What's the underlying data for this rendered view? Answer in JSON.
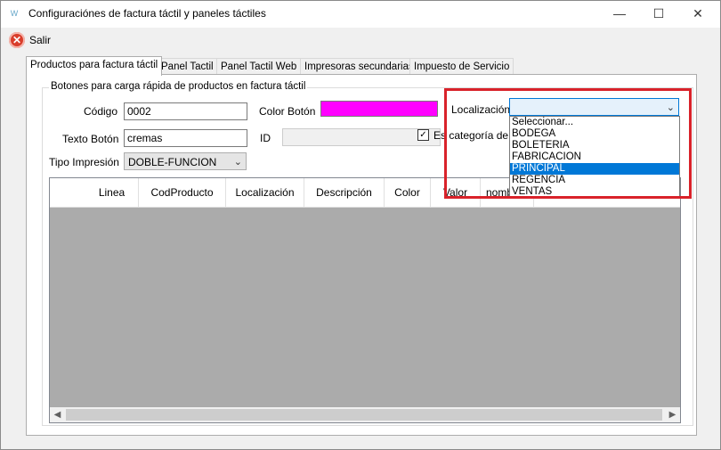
{
  "window": {
    "title": "Configuraciónes de factura táctil y paneles táctiles",
    "app_icon": "W"
  },
  "toolbar": {
    "exit_label": "Salir"
  },
  "tabs": [
    {
      "label": "Productos para factura táctil"
    },
    {
      "label": "Panel Tactil"
    },
    {
      "label": "Panel Tactil Web"
    },
    {
      "label": "Impresoras secundarias"
    },
    {
      "label": "Impuesto de Servicio"
    }
  ],
  "group": {
    "title": "Botones para carga rápida de productos  en factura táctil"
  },
  "form": {
    "codigo_label": "Código",
    "codigo_value": "0002",
    "texto_label": "Texto Botón",
    "texto_value": "cremas",
    "tipo_label": "Tipo Impresión",
    "tipo_value": "DOBLE-FUNCION",
    "color_label": "Color Botón",
    "color_value": "#ff00ff",
    "id_label": "ID",
    "id_value": "",
    "subcat_label": "Es categoría de p",
    "localizacion_label": "Localización",
    "localizacion_value": ""
  },
  "grid": {
    "columns": [
      "Linea",
      "CodProducto",
      "Localización",
      "Descripción",
      "Color",
      "Valor",
      "nomb"
    ]
  },
  "dropdown": {
    "options": [
      "Seleccionar...",
      "BODEGA",
      "BOLETERIA",
      "FABRICACION",
      "PRINCIPAL",
      "REGENCIA",
      "VENTAS"
    ],
    "selected": "PRINCIPAL"
  },
  "colors": {
    "highlight": "#d9222a",
    "selection": "#0078d7"
  }
}
